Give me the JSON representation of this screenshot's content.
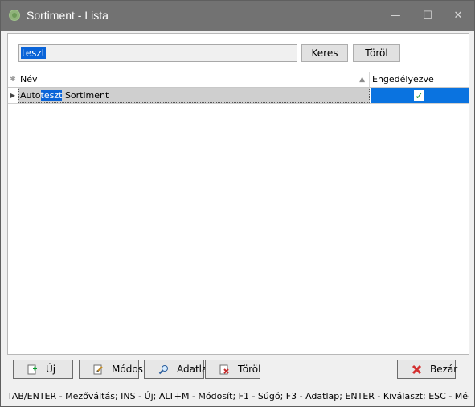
{
  "window": {
    "title": "Sortiment - Lista",
    "buttons": {
      "minimize": "—",
      "maximize": "☐",
      "close": "✕"
    }
  },
  "search": {
    "value": "teszt",
    "button_search": "Keres",
    "button_clear": "Töröl"
  },
  "grid": {
    "columns": {
      "indicator": "✱",
      "name": "Név",
      "enabled": "Engedélyezve"
    },
    "rows": [
      {
        "name_prefix": "Auto",
        "name_highlight": "teszt",
        "name_suffix": " Sortiment",
        "enabled": true,
        "checkmark": "✓",
        "indicator": "▶"
      }
    ]
  },
  "actions": {
    "new": {
      "label": "Új",
      "icon": "add-icon"
    },
    "edit": {
      "label": "Módosít",
      "icon": "edit-icon"
    },
    "details": {
      "label": "Adatlap",
      "icon": "search-icon"
    },
    "delete": {
      "label": "Töröl",
      "icon": "delete-icon"
    },
    "close": {
      "label": "Bezár",
      "icon": "close-icon"
    }
  },
  "status_bar": {
    "text": "TAB/ENTER - Mezőváltás; INS - Új; ALT+M - Módosít; F1 - Súgó; F3 - Adatlap; ENTER - Kiválaszt; ESC - Még"
  },
  "colors": {
    "title_bar": "#727272",
    "selection": "#0a64d8",
    "enabled_cell": "#0a73e0",
    "checkmark": "#168f2a"
  }
}
